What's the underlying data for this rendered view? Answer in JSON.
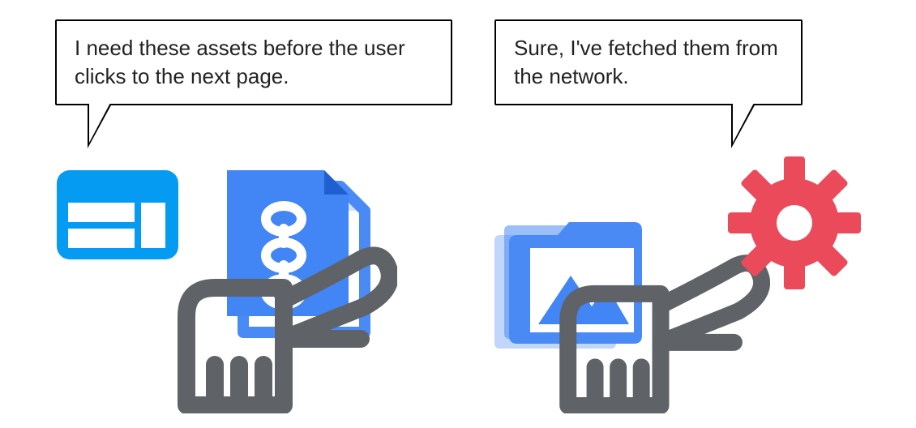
{
  "colors": {
    "bright_blue": "#069bf2",
    "mid_blue": "#4285f4",
    "mid_blue2": "#4a8af4",
    "grey": "#5f6368",
    "red": "#ea4a5a",
    "white": "#ffffff",
    "black": "#000000"
  },
  "speech": {
    "left": "I need these assets before the user clicks to the next page.",
    "right": "Sure, I've fetched them from the network."
  },
  "icons": {
    "webpage": "webpage-layout-icon",
    "document_chain": "document-with-chain-icon",
    "hand_left": "hand-offering-icon",
    "image_stack": "image-folder-stack-icon",
    "hand_right": "hand-offering-icon",
    "gear": "settings-gear-icon"
  }
}
